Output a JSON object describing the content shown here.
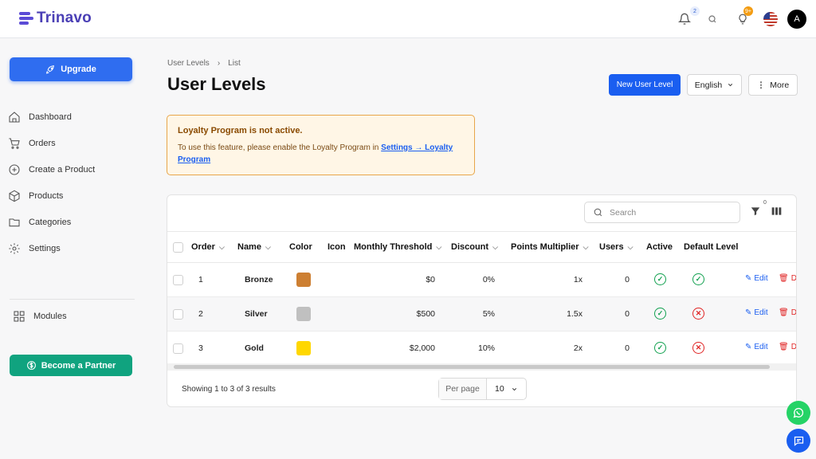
{
  "brand": {
    "name": "Trinavo"
  },
  "topbar": {
    "notifications_count": "2",
    "tips_count": "9+",
    "avatar_initial": "A"
  },
  "sidebar": {
    "upgrade_label": "Upgrade",
    "items": [
      {
        "label": "Dashboard",
        "icon": "home-icon"
      },
      {
        "label": "Orders",
        "icon": "cart-icon"
      },
      {
        "label": "Create a Product",
        "icon": "plus-circle-icon"
      },
      {
        "label": "Products",
        "icon": "box-icon"
      },
      {
        "label": "Categories",
        "icon": "folder-icon"
      },
      {
        "label": "Settings",
        "icon": "gear-icon"
      }
    ],
    "modules_label": "Modules",
    "partner_label": "Become a Partner"
  },
  "breadcrumb": {
    "parent": "User Levels",
    "current": "List"
  },
  "page": {
    "title": "User Levels",
    "new_button": "New User Level",
    "language": "English",
    "more_button": "More"
  },
  "alert": {
    "title": "Loyalty Program is not active.",
    "body": "To use this feature, please enable the Loyalty Program in",
    "link": "Settings → Loyalty Program"
  },
  "table": {
    "search_placeholder": "Search",
    "filter_count": "0",
    "columns": {
      "order": "Order",
      "name": "Name",
      "color": "Color",
      "icon": "Icon",
      "threshold": "Monthly Threshold",
      "discount": "Discount",
      "multiplier": "Points Multiplier",
      "users": "Users",
      "active": "Active",
      "default": "Default Level"
    },
    "rows": [
      {
        "order": "1",
        "name": "Bronze",
        "color": "#cd7f32",
        "threshold": "$0",
        "discount": "0%",
        "multiplier": "1x",
        "users": "0",
        "active": true,
        "default": true
      },
      {
        "order": "2",
        "name": "Silver",
        "color": "#c0c0c0",
        "threshold": "$500",
        "discount": "5%",
        "multiplier": "1.5x",
        "users": "0",
        "active": true,
        "default": false
      },
      {
        "order": "3",
        "name": "Gold",
        "color": "#ffd700",
        "threshold": "$2,000",
        "discount": "10%",
        "multiplier": "2x",
        "users": "0",
        "active": true,
        "default": false
      }
    ],
    "edit_label": "Edit",
    "delete_label": "De",
    "footer_text": "Showing 1 to 3 of 3 results",
    "per_page_label": "Per page",
    "per_page_value": "10"
  },
  "colors": {
    "primary": "#1a5ef0",
    "success": "#12a150",
    "danger": "#e02424",
    "partner": "#10a37f",
    "whatsapp": "#25d366",
    "chat": "#1a5ef0"
  }
}
